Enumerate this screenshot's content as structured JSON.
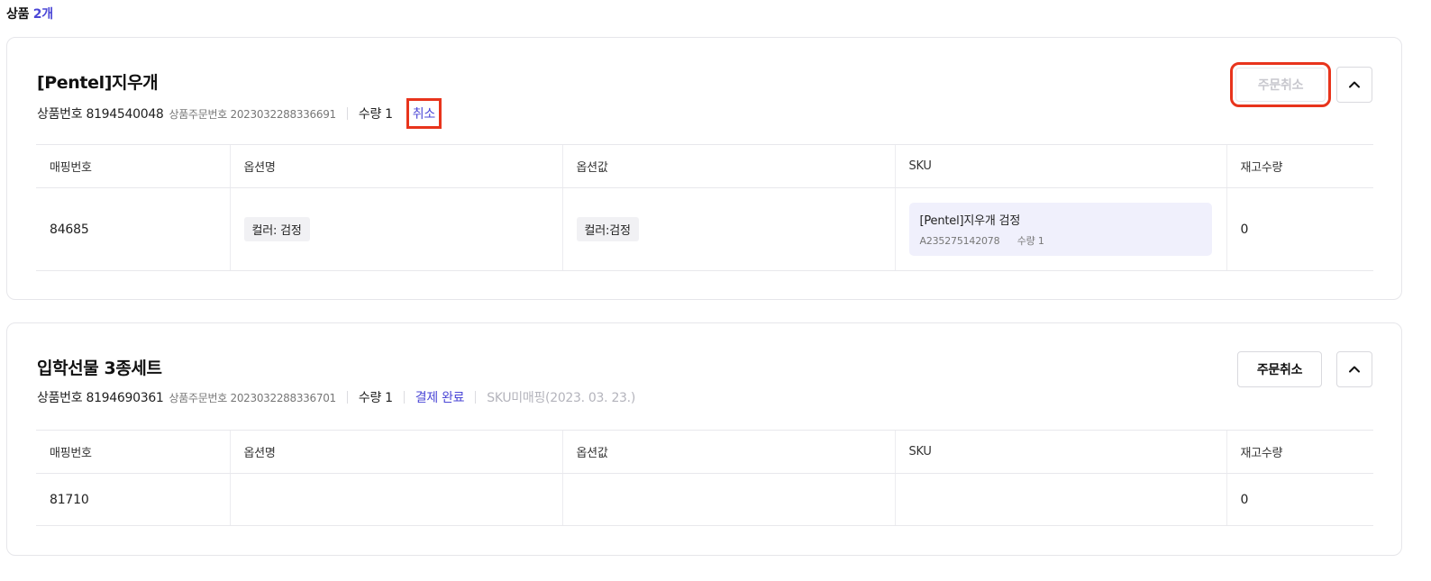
{
  "header": {
    "label": "상품",
    "count": "2개"
  },
  "products": [
    {
      "title": "[Pentel]지우개",
      "product_no": "상품번호 8194540048",
      "order_no": "상품주문번호 2023032288336691",
      "qty": "수량 1",
      "status": "취소",
      "cancel_button": "주문취소",
      "columns": [
        "매핑번호",
        "옵션명",
        "옵션값",
        "SKU",
        "재고수량"
      ],
      "row": {
        "mapping_no": "84685",
        "option_name": "컬러: 검정",
        "option_value": "컬러:검정",
        "sku_name": "[Pentel]지우개 검정",
        "sku_code": "A235275142078",
        "sku_qty": "수량 1",
        "stock": "0"
      }
    },
    {
      "title": "입학선물 3종세트",
      "product_no": "상품번호 8194690361",
      "order_no": "상품주문번호 2023032288336701",
      "qty": "수량 1",
      "status": "결제 완료",
      "sku_status": "SKU미매핑(2023. 03. 23.)",
      "cancel_button": "주문취소",
      "columns": [
        "매핑번호",
        "옵션명",
        "옵션값",
        "SKU",
        "재고수량"
      ],
      "row": {
        "mapping_no": "81710",
        "option_name": "",
        "option_value": "",
        "sku": "",
        "stock": "0"
      }
    }
  ],
  "colors": {
    "accent": "#4b47d6",
    "highlight": "#e8341c",
    "muted": "#b4b4bc"
  },
  "icons": {
    "collapse": "chevron-up-icon"
  }
}
